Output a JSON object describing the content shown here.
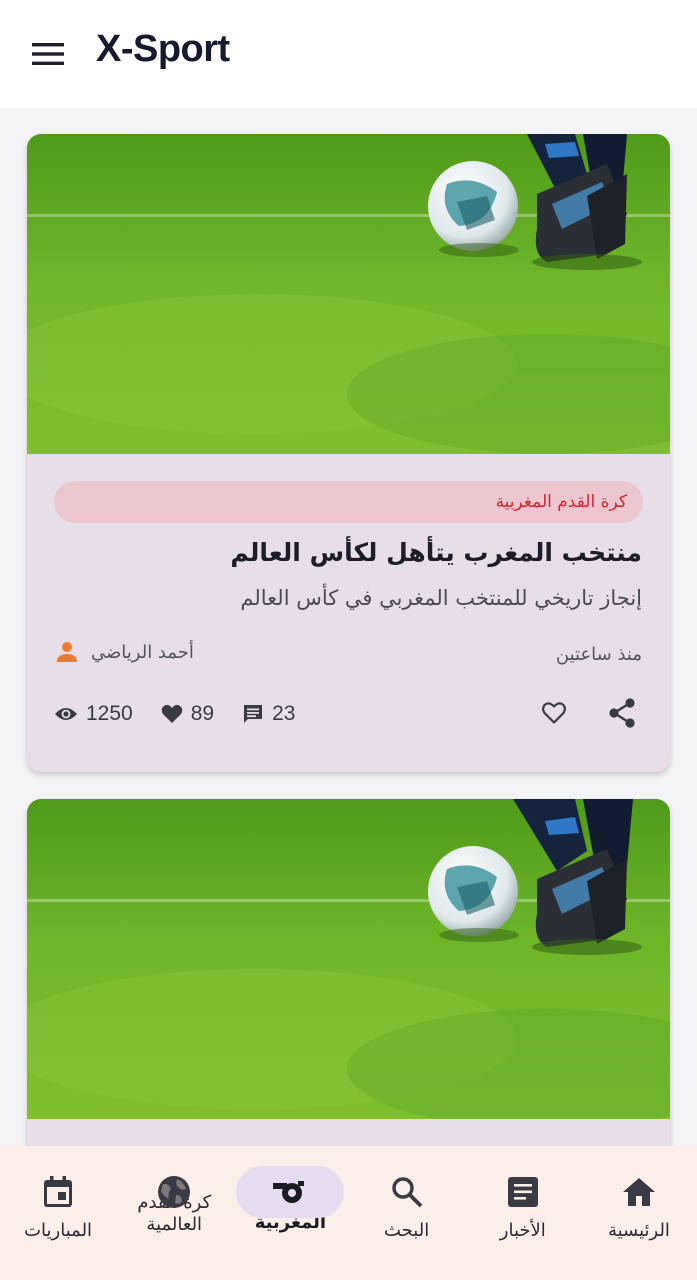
{
  "app": {
    "title": "X-Sport"
  },
  "articles": [
    {
      "category": "كرة القدم المغربية",
      "headline": "منتخب المغرب يتأهل لكأس العالم",
      "summary": "إنجاز تاريخي للمنتخب المغربي في كأس العالم",
      "author": "أحمد الرياضي",
      "time": "منذ ساعتين",
      "views": "1250",
      "likes": "89",
      "comments": "23"
    },
    {}
  ],
  "nav": {
    "items": [
      {
        "label": "المباريات",
        "icon": "calendar-icon"
      },
      {
        "label": "كرة القدم\nالعالمية",
        "icon": "globe-icon"
      },
      {
        "label": "كرة القدم\nالمغربية",
        "icon": "whistle-icon",
        "active": true
      },
      {
        "label": "البحث",
        "icon": "search-icon"
      },
      {
        "label": "الأخبار",
        "icon": "article-icon"
      },
      {
        "label": "الرئيسية",
        "icon": "home-icon"
      }
    ]
  },
  "colors": {
    "card_bg": "#e8deea",
    "chip_bg": "#ecc7d0",
    "chip_text": "#d8222e",
    "author_icon": "#ef7a2e",
    "nav_bg": "#fcefe9",
    "nav_active_pill": "#e8dcf2"
  }
}
